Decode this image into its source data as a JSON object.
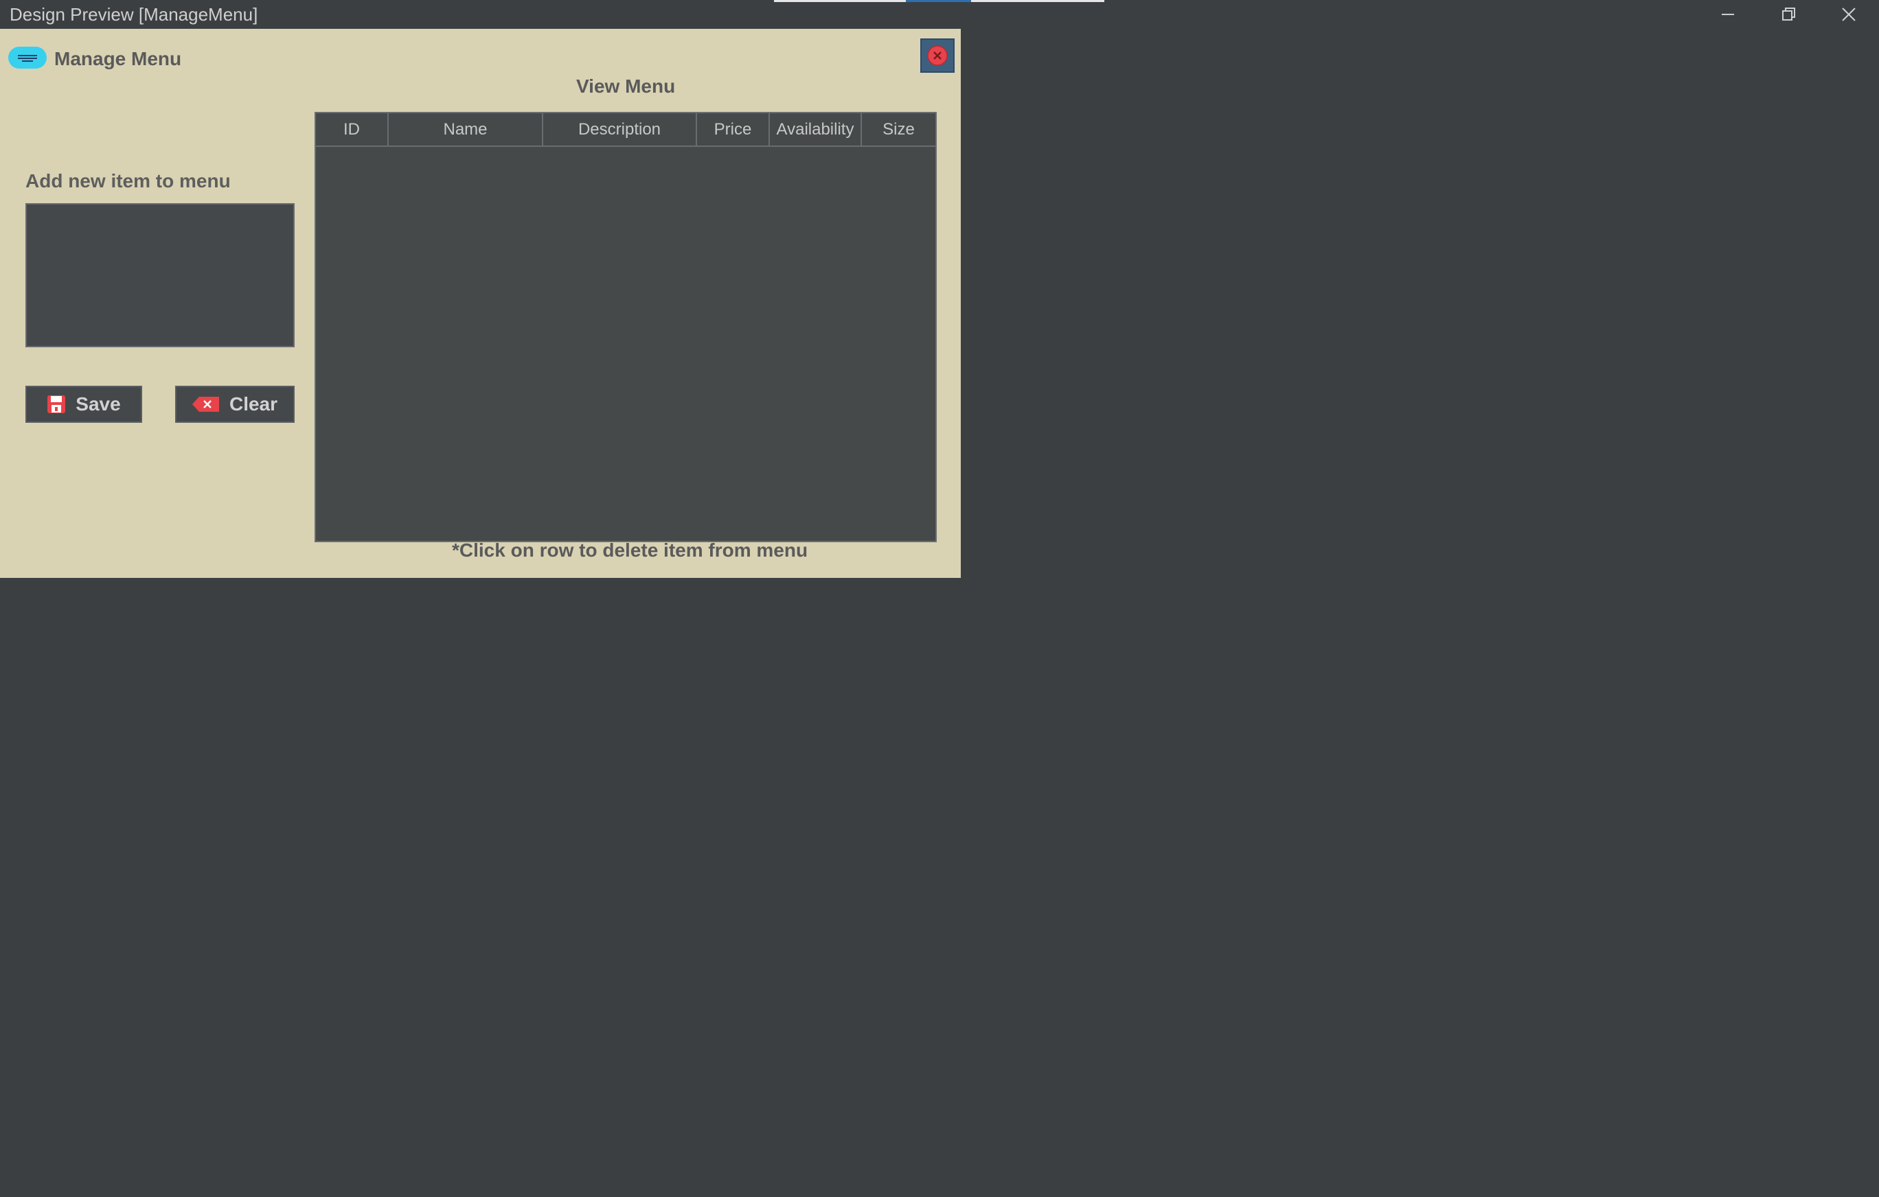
{
  "window": {
    "title": "Design Preview [ManageMenu]"
  },
  "frame": {
    "heading": "Manage Menu",
    "view_title": "View Menu",
    "add_label": "Add new item to menu",
    "save_label": "Save",
    "clear_label": "Clear",
    "hint": "*Click on row to delete item from menu"
  },
  "table": {
    "columns": [
      "ID",
      "Name",
      "Description",
      "Price",
      "Availability",
      "Size"
    ],
    "rows": []
  },
  "icons": {
    "logo": "menu-icon",
    "close": "close-circle-icon",
    "save": "floppy-disk-icon",
    "clear": "backspace-x-icon",
    "minimize": "minimize-icon",
    "restore": "restore-icon",
    "window_close": "close-icon"
  },
  "colors": {
    "frame_bg": "#d9d3b4",
    "dark_bg": "#3c3f41",
    "panel_bg": "#45484a",
    "logo_cyan": "#37d1ee",
    "accent_red": "#e8424a"
  }
}
